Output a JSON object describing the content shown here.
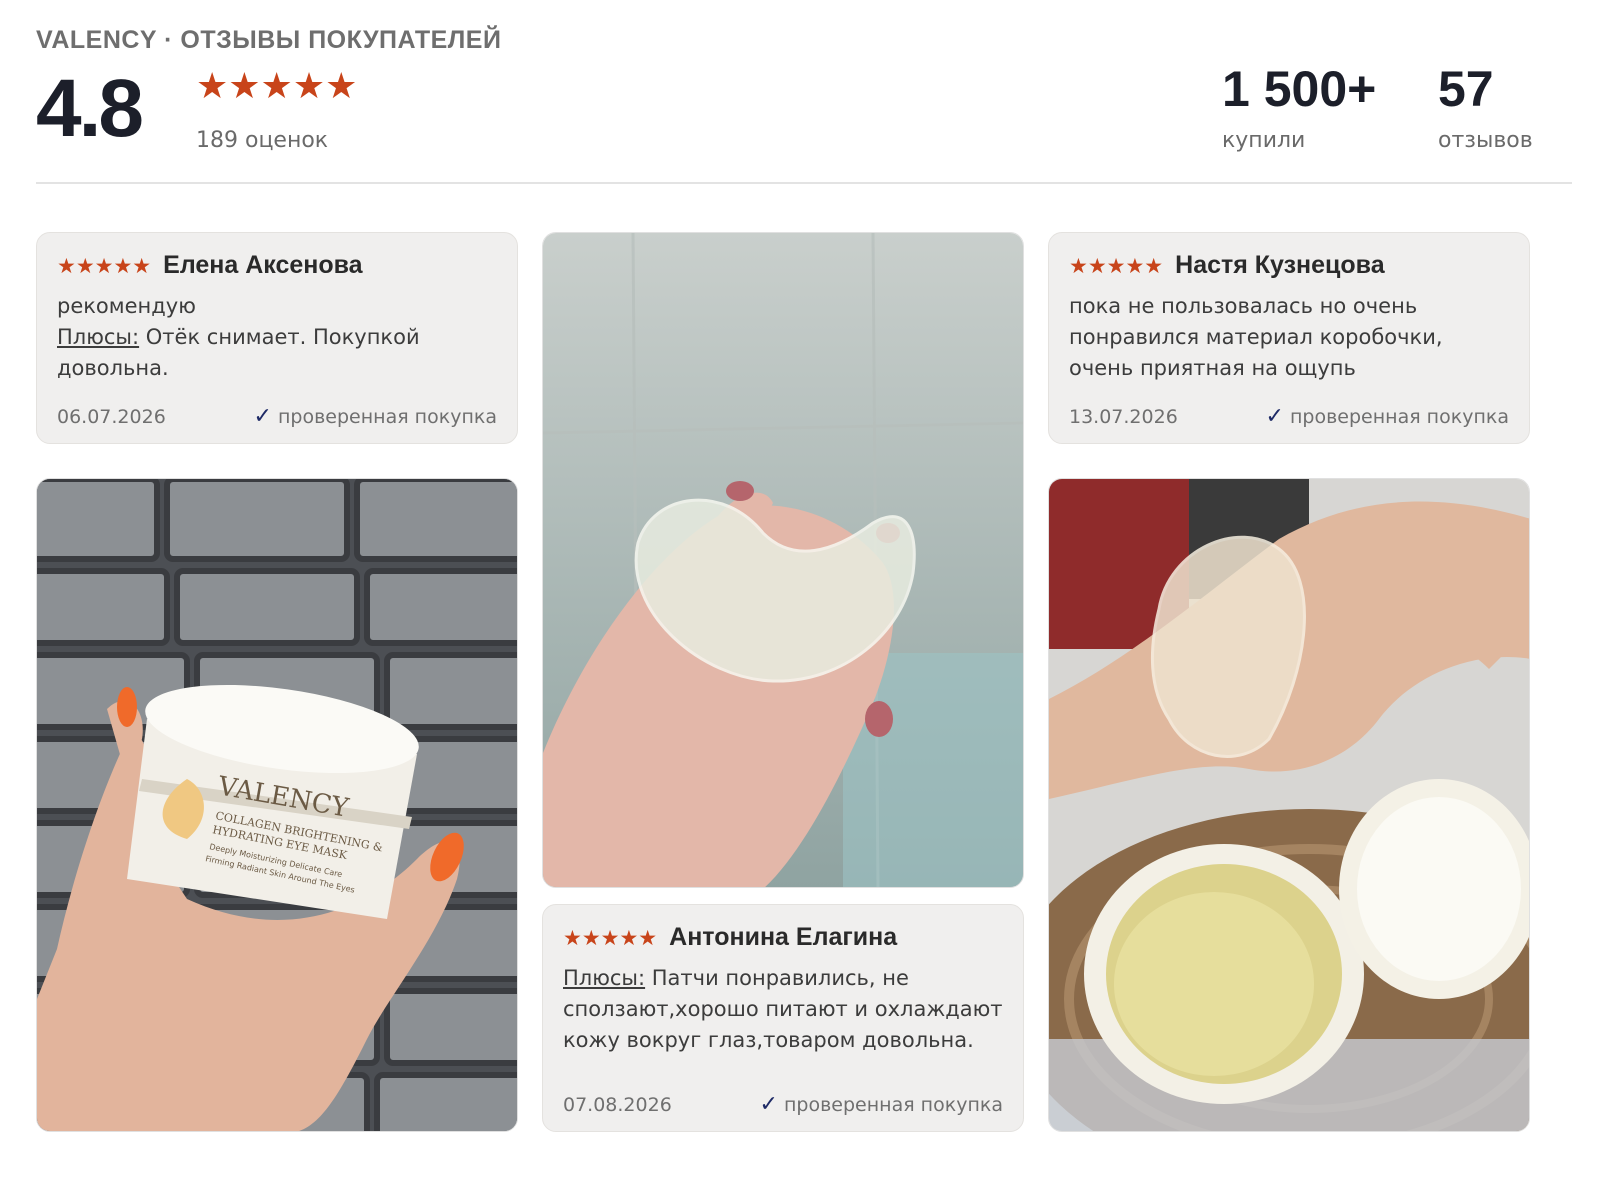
{
  "header": {
    "brand_line": "VALENCY · ОТЗЫВЫ ПОКУПАТЕЛЕЙ",
    "rating": "4.8",
    "stars": "★★★★★",
    "ratings_count": "189 оценок",
    "bought_value": "1 500+",
    "bought_label": "купили",
    "reviews_value": "57",
    "reviews_label": "отзывов"
  },
  "reviews": [
    {
      "stars": "★★★★★",
      "author": "Елена Аксенова",
      "text_first": "рекомендую",
      "plus_label": "Плюсы:",
      "plus_text": " Отёк снимает. Покупкой довольна.",
      "date": "06.07.2026",
      "check": "✓",
      "verified": "проверенная покупка"
    },
    {
      "stars": "★★★★★",
      "author": "Настя Кузнецова",
      "text": "пока не пользовалась но очень понравился материал коробочки, очень приятная на ощупь",
      "date": "13.07.2026",
      "check": "✓",
      "verified": "проверенная покупка"
    },
    {
      "stars": "★★★★★",
      "author": "Антонина Елагина",
      "plus_label": "Плюсы:",
      "plus_text": " Патчи понравились, не сползают,хорошо питают и охлаждают кожу вокруг глаз,товаром довольна.",
      "date": "07.08.2026",
      "check": "✓",
      "verified": "проверенная покупка"
    }
  ],
  "photos": {
    "jar_brand": "VALENCY",
    "jar_line1": "COLLAGEN BRIGHTENING &",
    "jar_line2": "HYDRATING EYE MASK",
    "jar_line3": "Deeply Moisturizing Delicate Care",
    "jar_line4": "Firming Radiant Skin Around The Eyes"
  },
  "colors": {
    "accent_star": "#c8441a",
    "check": "#1e2a66",
    "card_bg": "#f0efee"
  }
}
